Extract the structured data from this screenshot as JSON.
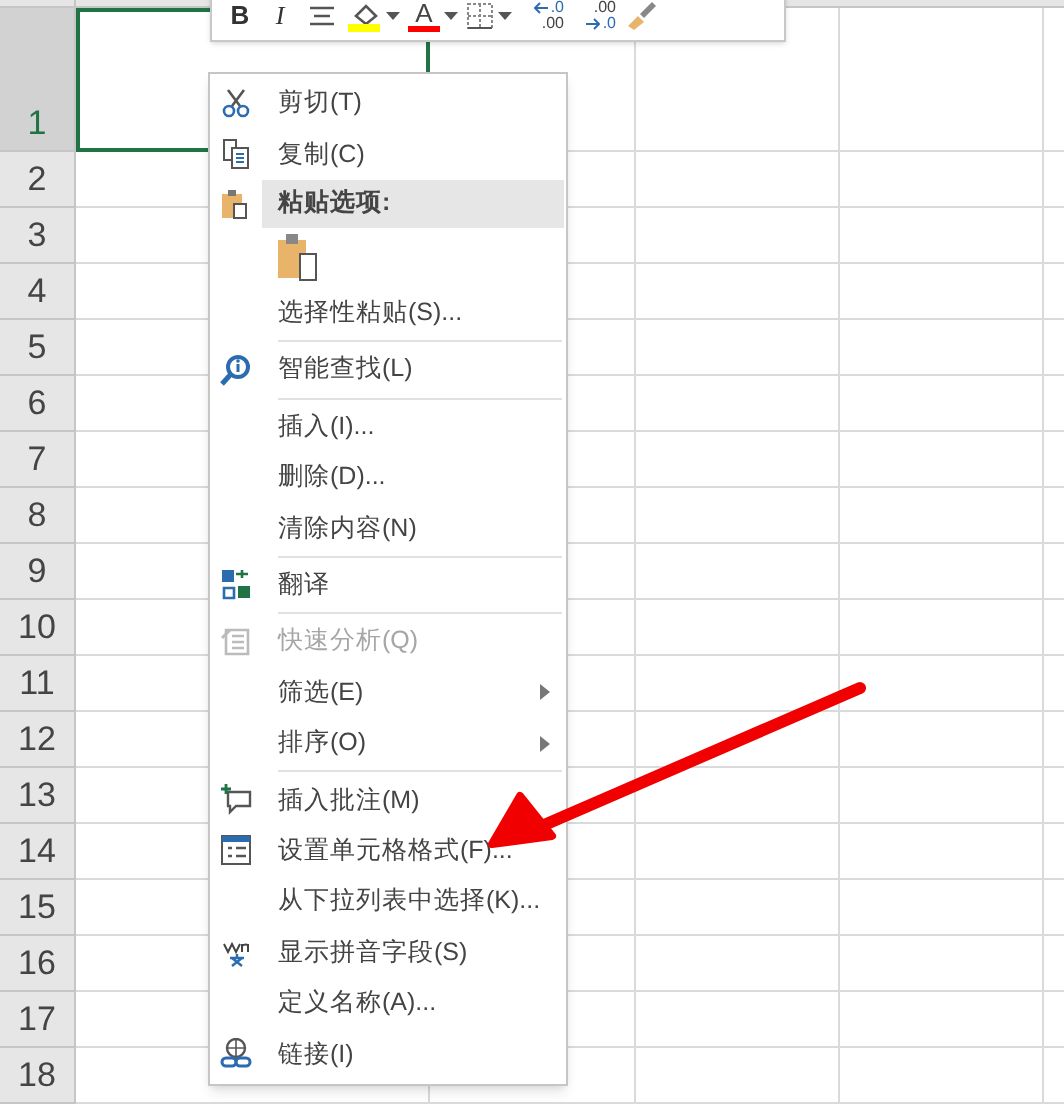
{
  "toolbar": {
    "items": [
      {
        "kind": "bold",
        "label": "B"
      },
      {
        "kind": "italic",
        "label": "I"
      },
      {
        "kind": "align"
      },
      {
        "kind": "fill",
        "dropdown": true
      },
      {
        "kind": "fontcolor",
        "label": "A",
        "dropdown": true
      },
      {
        "kind": "border",
        "dropdown": true
      },
      {
        "kind": "decimal",
        "top": ".0",
        "bottom": ".00"
      },
      {
        "kind": "decimal",
        "top": ".00",
        "bottom": ".0"
      },
      {
        "kind": "painter"
      }
    ]
  },
  "sheet": {
    "rows": [
      {
        "label": "1",
        "selected": true
      },
      {
        "label": "2",
        "selected": false
      },
      {
        "label": "3",
        "selected": false
      },
      {
        "label": "4",
        "selected": false
      },
      {
        "label": "5",
        "selected": false
      },
      {
        "label": "6",
        "selected": false
      },
      {
        "label": "7",
        "selected": false
      },
      {
        "label": "8",
        "selected": false
      },
      {
        "label": "9",
        "selected": false
      },
      {
        "label": "10",
        "selected": false
      },
      {
        "label": "11",
        "selected": false
      },
      {
        "label": "12",
        "selected": false
      },
      {
        "label": "13",
        "selected": false
      },
      {
        "label": "14",
        "selected": false
      },
      {
        "label": "15",
        "selected": false
      },
      {
        "label": "16",
        "selected": false
      },
      {
        "label": "17",
        "selected": false
      },
      {
        "label": "18",
        "selected": false
      }
    ]
  },
  "context_menu": {
    "items": [
      {
        "kind": "item",
        "label": "剪切(T)",
        "disabled": false,
        "submenu": false
      },
      {
        "kind": "item",
        "label": "复制(C)",
        "disabled": false,
        "submenu": false
      },
      {
        "kind": "header",
        "label": "粘贴选项:"
      },
      {
        "kind": "paste_options"
      },
      {
        "kind": "item",
        "label": "选择性粘贴(S)...",
        "disabled": false,
        "submenu": false
      },
      {
        "kind": "separator"
      },
      {
        "kind": "item",
        "label": "智能查找(L)",
        "disabled": false,
        "submenu": false
      },
      {
        "kind": "separator"
      },
      {
        "kind": "item",
        "label": "插入(I)...",
        "disabled": false,
        "submenu": false
      },
      {
        "kind": "item",
        "label": "删除(D)...",
        "disabled": false,
        "submenu": false
      },
      {
        "kind": "item",
        "label": "清除内容(N)",
        "disabled": false,
        "submenu": false
      },
      {
        "kind": "separator"
      },
      {
        "kind": "item",
        "label": "翻译",
        "disabled": false,
        "submenu": false
      },
      {
        "kind": "separator"
      },
      {
        "kind": "item",
        "label": "快速分析(Q)",
        "disabled": true,
        "submenu": false
      },
      {
        "kind": "item",
        "label": "筛选(E)",
        "disabled": false,
        "submenu": true
      },
      {
        "kind": "item",
        "label": "排序(O)",
        "disabled": false,
        "submenu": true
      },
      {
        "kind": "separator"
      },
      {
        "kind": "item",
        "label": "插入批注(M)",
        "disabled": false,
        "submenu": false
      },
      {
        "kind": "item",
        "label": "设置单元格格式(F)...",
        "disabled": false,
        "submenu": false
      },
      {
        "kind": "item",
        "label": "从下拉列表中选择(K)...",
        "disabled": false,
        "submenu": false
      },
      {
        "kind": "item",
        "label": "显示拼音字段(S)",
        "disabled": false,
        "submenu": false
      },
      {
        "kind": "item",
        "label": "定义名称(A)...",
        "disabled": false,
        "submenu": false
      },
      {
        "kind": "item",
        "label": "链接(I)",
        "disabled": false,
        "submenu": false
      }
    ]
  }
}
